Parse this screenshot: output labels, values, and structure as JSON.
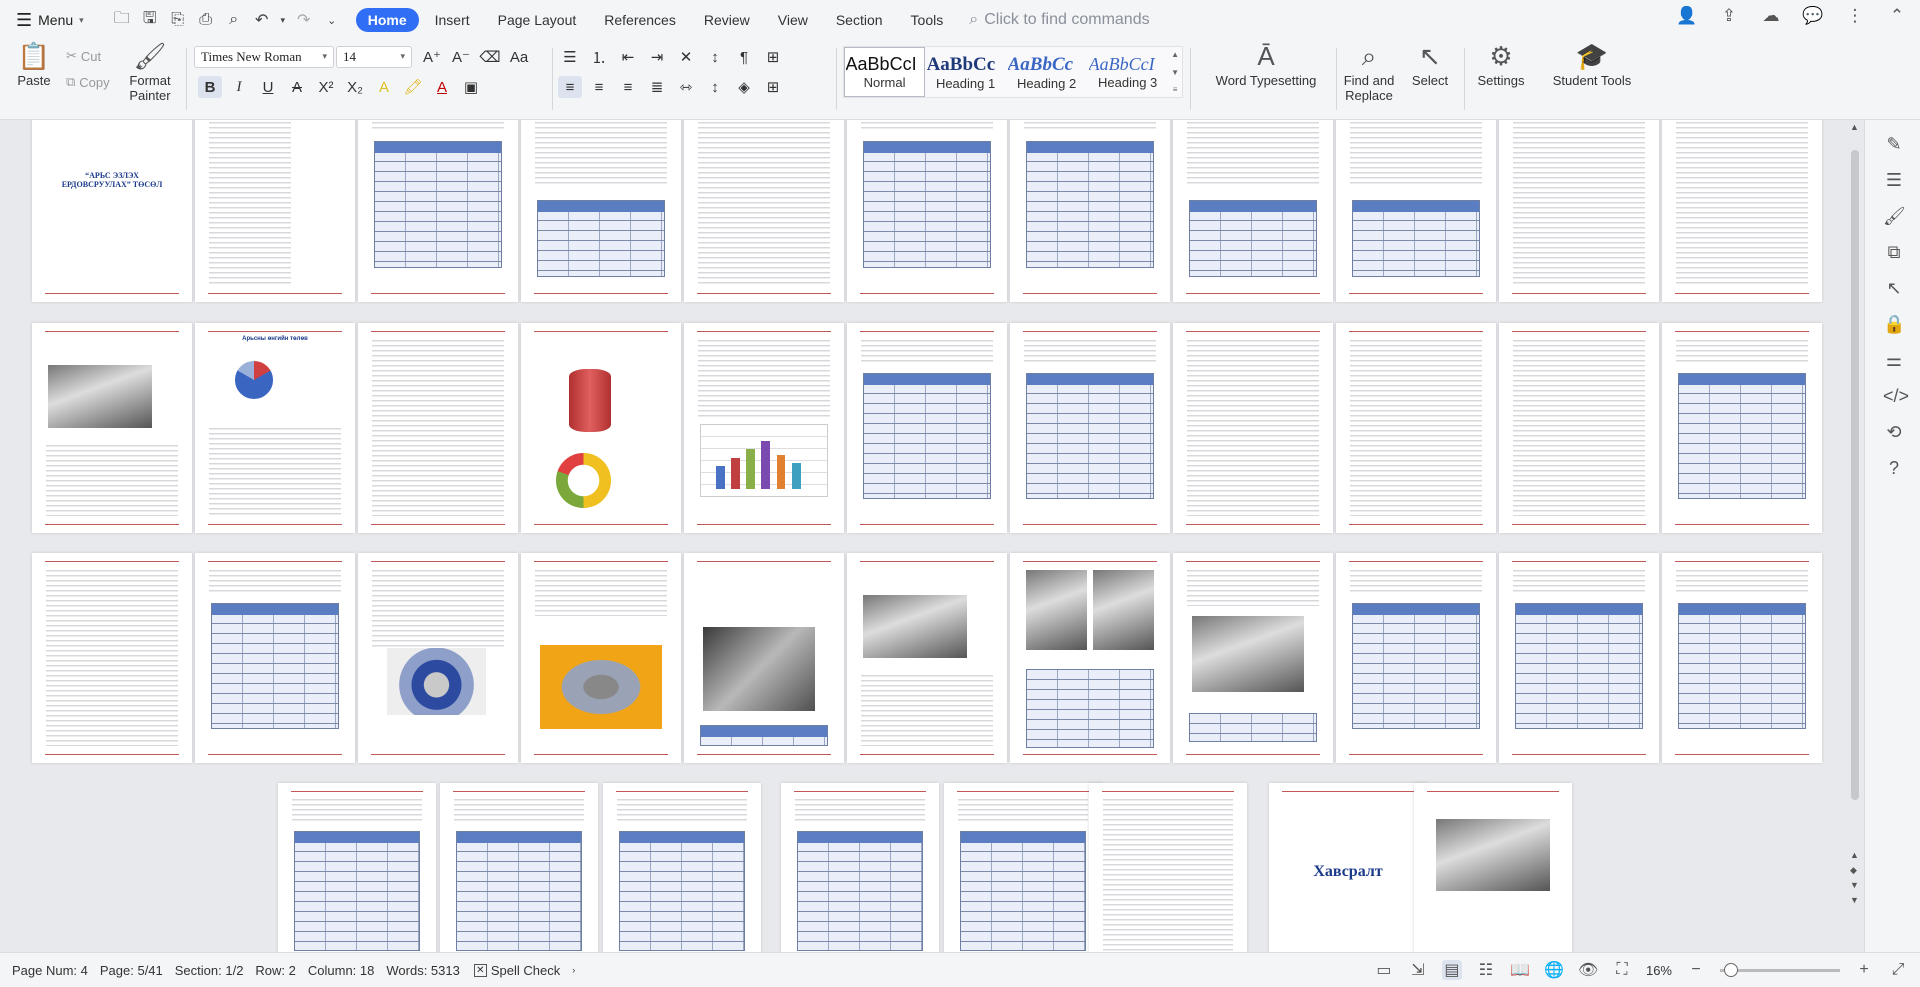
{
  "topbar": {
    "menu_label": "Menu",
    "tabs": [
      {
        "label": "Home",
        "active": true
      },
      {
        "label": "Insert"
      },
      {
        "label": "Page Layout"
      },
      {
        "label": "References"
      },
      {
        "label": "Review"
      },
      {
        "label": "View"
      },
      {
        "label": "Section"
      },
      {
        "label": "Tools"
      }
    ],
    "search_placeholder": "Click to find commands"
  },
  "ribbon": {
    "paste": "Paste",
    "cut": "Cut",
    "copy": "Copy",
    "format_painter_1": "Format",
    "format_painter_2": "Painter",
    "font_name": "Times New Roman",
    "font_size": "14",
    "styles": [
      {
        "sample": "AaBbCcI",
        "label": "Normal"
      },
      {
        "sample": "AaBbCc",
        "label": "Heading 1"
      },
      {
        "sample": "AaBbCc",
        "label": "Heading 2"
      },
      {
        "sample": "AaBbCcI",
        "label": "Heading 3"
      }
    ],
    "word_typesetting": "Word Typesetting",
    "find_replace_1": "Find and",
    "find_replace_2": "Replace",
    "select": "Select",
    "settings": "Settings",
    "student_tools": "Student Tools"
  },
  "document": {
    "cover_title": "“АРЬС ЭЗЛЭХ ЕРДОВСРУУЛАХ” ТӨСӨЛ",
    "chart_title": "Арьсны өнгийн төлөв",
    "appendix_title": "Хавсралт"
  },
  "status": {
    "page_num": "Page Num: 4",
    "page": "Page: 5/41",
    "section": "Section: 1/2",
    "row": "Row: 2",
    "column": "Column: 18",
    "words": "Words: 5313",
    "spell_check": "Spell Check",
    "zoom": "16%"
  },
  "colors": {
    "accent": "#2f6ef5",
    "header_rule": "#c05858",
    "table_header": "#5b7ec2"
  }
}
